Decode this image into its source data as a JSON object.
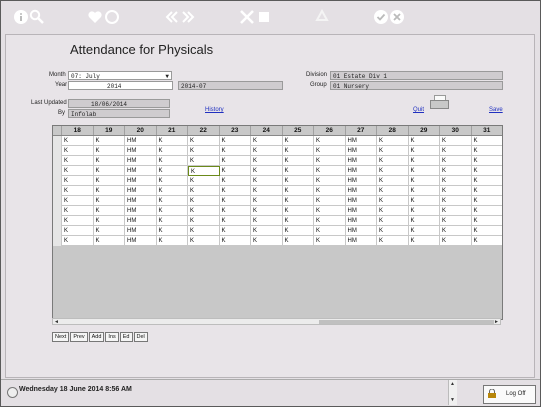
{
  "toolbar": {
    "icons": [
      "info-icon",
      "search-icon",
      "heart-icon",
      "circle-icon",
      "first-icon",
      "last-icon",
      "tools-icon",
      "square-icon",
      "recycle-icon",
      "check-icon",
      "cancel-icon"
    ]
  },
  "form": {
    "title": "Attendance for Physicals",
    "month_label": "Month",
    "month_value": "07: July",
    "year_label": "Year",
    "year_value": "2014",
    "period_value": "2014-07",
    "division_label": "Division",
    "division_value": "01 Estate Div 1",
    "group_label": "Group",
    "group_value": "01 Nursery",
    "last_updated_label": "Last Updated",
    "last_updated_value": "18/06/2014",
    "by_label": "By",
    "by_value": "Infolab",
    "history_link": "History",
    "quit_link": "Quit",
    "save_link": "Save"
  },
  "grid": {
    "columns": [
      "18",
      "19",
      "20",
      "21",
      "22",
      "23",
      "24",
      "25",
      "26",
      "27",
      "28",
      "29",
      "30",
      "31"
    ],
    "rows": [
      [
        "K",
        "K",
        "HM",
        "K",
        "K",
        "K",
        "K",
        "K",
        "K",
        "HM",
        "K",
        "K",
        "K",
        "K"
      ],
      [
        "K",
        "K",
        "HM",
        "K",
        "K",
        "K",
        "K",
        "K",
        "K",
        "HM",
        "K",
        "K",
        "K",
        "K"
      ],
      [
        "K",
        "K",
        "HM",
        "K",
        "K",
        "K",
        "K",
        "K",
        "K",
        "HM",
        "K",
        "K",
        "K",
        "K"
      ],
      [
        "K",
        "K",
        "HM",
        "K",
        "K",
        "K",
        "K",
        "K",
        "K",
        "HM",
        "K",
        "K",
        "K",
        "K"
      ],
      [
        "K",
        "K",
        "HM",
        "K",
        "K",
        "K",
        "K",
        "K",
        "K",
        "HM",
        "K",
        "K",
        "K",
        "K"
      ],
      [
        "K",
        "K",
        "HM",
        "K",
        "K",
        "K",
        "K",
        "K",
        "K",
        "HM",
        "K",
        "K",
        "K",
        "K"
      ],
      [
        "K",
        "K",
        "HM",
        "K",
        "K",
        "K",
        "K",
        "K",
        "K",
        "HM",
        "K",
        "K",
        "K",
        "K"
      ],
      [
        "K",
        "K",
        "HM",
        "K",
        "K",
        "K",
        "K",
        "K",
        "K",
        "HM",
        "K",
        "K",
        "K",
        "K"
      ],
      [
        "K",
        "K",
        "HM",
        "K",
        "K",
        "K",
        "K",
        "K",
        "K",
        "HM",
        "K",
        "K",
        "K",
        "K"
      ],
      [
        "K",
        "K",
        "HM",
        "K",
        "K",
        "K",
        "K",
        "K",
        "K",
        "HM",
        "K",
        "K",
        "K",
        "K"
      ],
      [
        "K",
        "K",
        "HM",
        "K",
        "K",
        "K",
        "K",
        "K",
        "K",
        "HM",
        "K",
        "K",
        "K",
        "K"
      ]
    ],
    "selected_row": 3,
    "selected_col": 4
  },
  "scroll": {
    "left_arrow": "◄",
    "right_arrow": "►"
  },
  "nav_buttons": [
    "Next",
    "Prev",
    "Add",
    "Ins",
    "Ed",
    "Del"
  ],
  "status_bar": {
    "datetime": "Wednesday 18 June 2014 8:56 AM",
    "logoff_label": "Log Off"
  }
}
